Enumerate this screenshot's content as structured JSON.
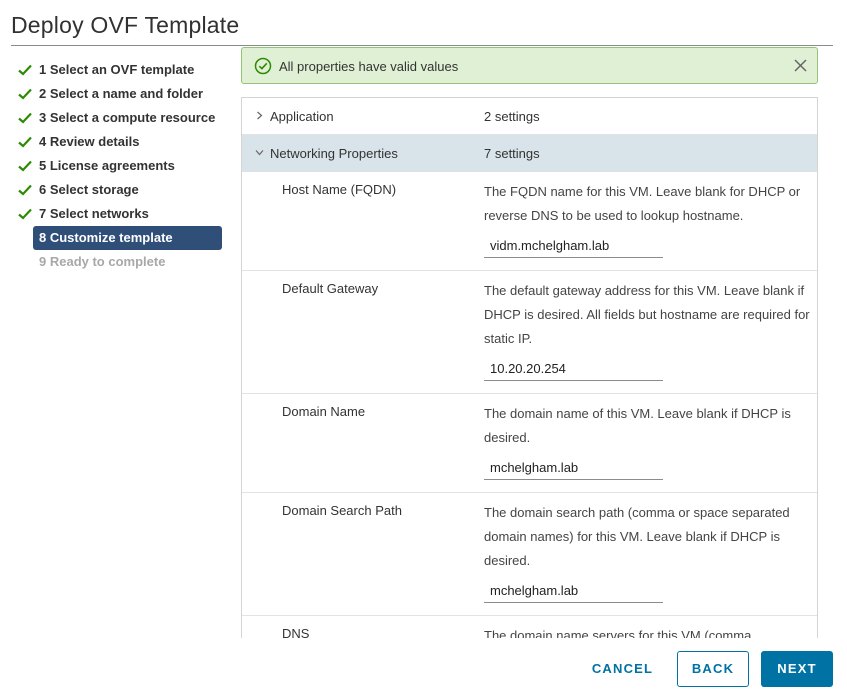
{
  "window": {
    "title": "Deploy OVF Template"
  },
  "steps": [
    {
      "label": "1 Select an OVF template",
      "state": "done"
    },
    {
      "label": "2 Select a name and folder",
      "state": "done"
    },
    {
      "label": "3 Select a compute resource",
      "state": "done"
    },
    {
      "label": "4 Review details",
      "state": "done"
    },
    {
      "label": "5 License agreements",
      "state": "done"
    },
    {
      "label": "6 Select storage",
      "state": "done"
    },
    {
      "label": "7 Select networks",
      "state": "done"
    },
    {
      "label": "8 Customize template",
      "state": "current"
    },
    {
      "label": "9 Ready to complete",
      "state": "future"
    }
  ],
  "alert": {
    "message": "All properties have valid values",
    "icon": "check-circle-icon"
  },
  "groups": {
    "application": {
      "name": "Application",
      "count": "2 settings",
      "expanded": false
    },
    "networking": {
      "name": "Networking Properties",
      "count": "7 settings",
      "expanded": true
    }
  },
  "properties": [
    {
      "name": "Host Name (FQDN)",
      "description": "The FQDN name for this VM. Leave blank for DHCP or reverse DNS to be used to lookup hostname.",
      "value": "vidm.mchelgham.lab"
    },
    {
      "name": "Default Gateway",
      "description": "The default gateway address for this VM. Leave blank if DHCP is desired. All fields but hostname are required for static IP.",
      "value": "10.20.20.254"
    },
    {
      "name": "Domain Name",
      "description": "The domain name of this VM. Leave blank if DHCP is desired.",
      "value": "mchelgham.lab"
    },
    {
      "name": "Domain Search Path",
      "description": "The domain search path (comma or space separated domain names) for this VM. Leave blank if DHCP is desired.",
      "value": "mchelgham.lab"
    },
    {
      "name": "DNS",
      "description": "The domain name servers for this VM (comma"
    }
  ],
  "buttons": {
    "cancel": "CANCEL",
    "back": "BACK",
    "next": "NEXT"
  },
  "colors": {
    "accent": "#0072a3",
    "current_step": "#2f4e78",
    "success": "#2e8a00",
    "success_bg": "#e0f0d4",
    "group_open_bg": "#d8e3ea"
  }
}
